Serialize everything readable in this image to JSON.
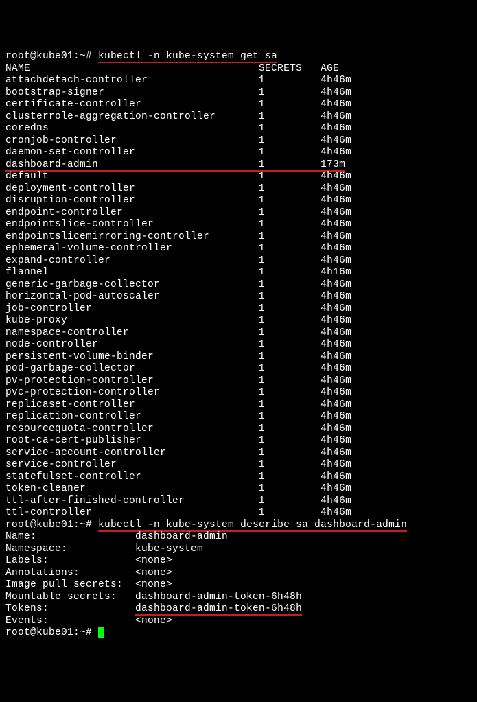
{
  "prompt1": "root@kube01:~# ",
  "command1": "kubectl -n kube-system get sa",
  "header": {
    "name": "NAME",
    "secrets": "SECRETS",
    "age": "AGE"
  },
  "rows": [
    {
      "name": "attachdetach-controller",
      "secrets": "1",
      "age": "4h46m",
      "highlight": false
    },
    {
      "name": "bootstrap-signer",
      "secrets": "1",
      "age": "4h46m",
      "highlight": false
    },
    {
      "name": "certificate-controller",
      "secrets": "1",
      "age": "4h46m",
      "highlight": false
    },
    {
      "name": "clusterrole-aggregation-controller",
      "secrets": "1",
      "age": "4h46m",
      "highlight": false
    },
    {
      "name": "coredns",
      "secrets": "1",
      "age": "4h46m",
      "highlight": false
    },
    {
      "name": "cronjob-controller",
      "secrets": "1",
      "age": "4h46m",
      "highlight": false
    },
    {
      "name": "daemon-set-controller",
      "secrets": "1",
      "age": "4h46m",
      "highlight": false
    },
    {
      "name": "dashboard-admin",
      "secrets": "1",
      "age": "173m",
      "highlight": true
    },
    {
      "name": "default",
      "secrets": "1",
      "age": "4h46m",
      "highlight": false
    },
    {
      "name": "deployment-controller",
      "secrets": "1",
      "age": "4h46m",
      "highlight": false
    },
    {
      "name": "disruption-controller",
      "secrets": "1",
      "age": "4h46m",
      "highlight": false
    },
    {
      "name": "endpoint-controller",
      "secrets": "1",
      "age": "4h46m",
      "highlight": false
    },
    {
      "name": "endpointslice-controller",
      "secrets": "1",
      "age": "4h46m",
      "highlight": false
    },
    {
      "name": "endpointslicemirroring-controller",
      "secrets": "1",
      "age": "4h46m",
      "highlight": false
    },
    {
      "name": "ephemeral-volume-controller",
      "secrets": "1",
      "age": "4h46m",
      "highlight": false
    },
    {
      "name": "expand-controller",
      "secrets": "1",
      "age": "4h46m",
      "highlight": false
    },
    {
      "name": "flannel",
      "secrets": "1",
      "age": "4h16m",
      "highlight": false
    },
    {
      "name": "generic-garbage-collector",
      "secrets": "1",
      "age": "4h46m",
      "highlight": false
    },
    {
      "name": "horizontal-pod-autoscaler",
      "secrets": "1",
      "age": "4h46m",
      "highlight": false
    },
    {
      "name": "job-controller",
      "secrets": "1",
      "age": "4h46m",
      "highlight": false
    },
    {
      "name": "kube-proxy",
      "secrets": "1",
      "age": "4h46m",
      "highlight": false
    },
    {
      "name": "namespace-controller",
      "secrets": "1",
      "age": "4h46m",
      "highlight": false
    },
    {
      "name": "node-controller",
      "secrets": "1",
      "age": "4h46m",
      "highlight": false
    },
    {
      "name": "persistent-volume-binder",
      "secrets": "1",
      "age": "4h46m",
      "highlight": false
    },
    {
      "name": "pod-garbage-collector",
      "secrets": "1",
      "age": "4h46m",
      "highlight": false
    },
    {
      "name": "pv-protection-controller",
      "secrets": "1",
      "age": "4h46m",
      "highlight": false
    },
    {
      "name": "pvc-protection-controller",
      "secrets": "1",
      "age": "4h46m",
      "highlight": false
    },
    {
      "name": "replicaset-controller",
      "secrets": "1",
      "age": "4h46m",
      "highlight": false
    },
    {
      "name": "replication-controller",
      "secrets": "1",
      "age": "4h46m",
      "highlight": false
    },
    {
      "name": "resourcequota-controller",
      "secrets": "1",
      "age": "4h46m",
      "highlight": false
    },
    {
      "name": "root-ca-cert-publisher",
      "secrets": "1",
      "age": "4h46m",
      "highlight": false
    },
    {
      "name": "service-account-controller",
      "secrets": "1",
      "age": "4h46m",
      "highlight": false
    },
    {
      "name": "service-controller",
      "secrets": "1",
      "age": "4h46m",
      "highlight": false
    },
    {
      "name": "statefulset-controller",
      "secrets": "1",
      "age": "4h46m",
      "highlight": false
    },
    {
      "name": "token-cleaner",
      "secrets": "1",
      "age": "4h46m",
      "highlight": false
    },
    {
      "name": "ttl-after-finished-controller",
      "secrets": "1",
      "age": "4h46m",
      "highlight": false
    },
    {
      "name": "ttl-controller",
      "secrets": "1",
      "age": "4h46m",
      "highlight": false
    }
  ],
  "prompt2": "root@kube01:~# ",
  "command2": "kubectl -n kube-system describe sa dashboard-admin",
  "describe": [
    {
      "label": "Name:",
      "value": "dashboard-admin",
      "highlight": false
    },
    {
      "label": "Namespace:",
      "value": "kube-system",
      "highlight": false
    },
    {
      "label": "Labels:",
      "value": "<none>",
      "highlight": false
    },
    {
      "label": "Annotations:",
      "value": "<none>",
      "highlight": false
    },
    {
      "label": "Image pull secrets:",
      "value": "<none>",
      "highlight": false
    },
    {
      "label": "Mountable secrets:",
      "value": "dashboard-admin-token-6h48h",
      "highlight": false
    },
    {
      "label": "Tokens:",
      "value": "dashboard-admin-token-6h48h",
      "highlight": true
    },
    {
      "label": "Events:",
      "value": "<none>",
      "highlight": false
    }
  ],
  "prompt3": "root@kube01:~# "
}
